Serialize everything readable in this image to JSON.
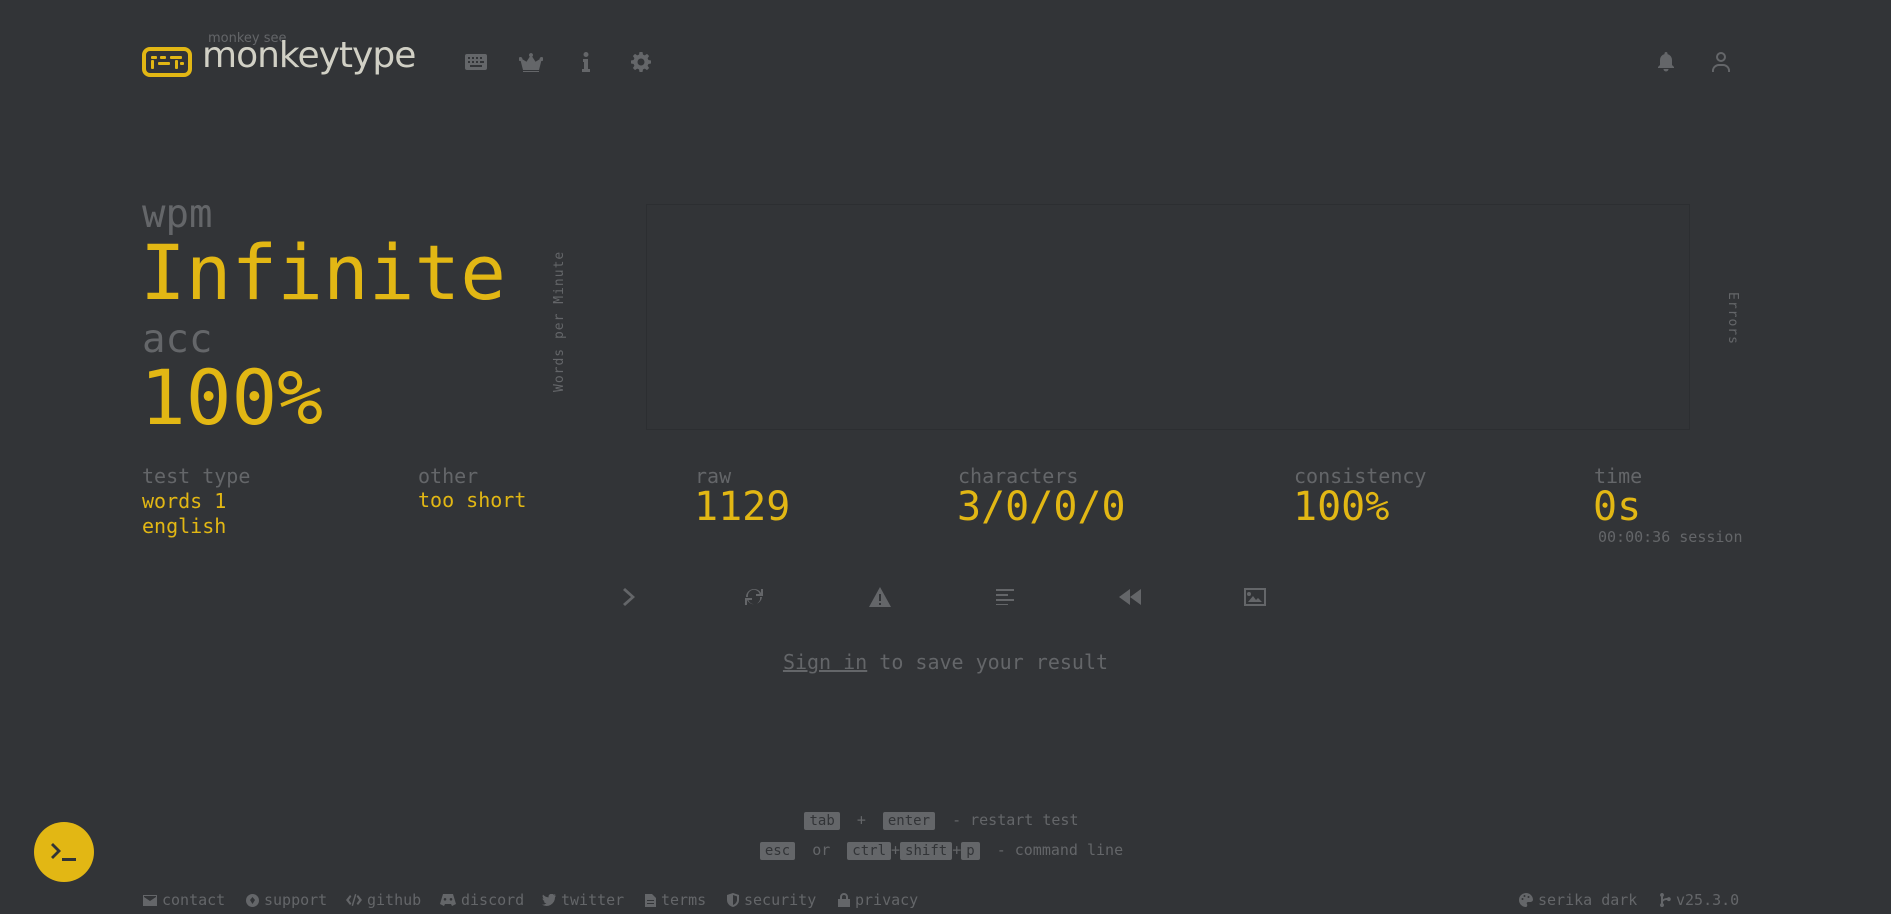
{
  "header": {
    "logo_sub": "monkey see",
    "logo_text": "monkeytype",
    "nav_icons": [
      "keyboard-icon",
      "crown-icon",
      "info-icon",
      "gear-icon"
    ],
    "right_icons": [
      "bell-icon",
      "user-icon"
    ]
  },
  "result": {
    "wpm_label": "wpm",
    "wpm_value": "Infinite",
    "acc_label": "acc",
    "acc_value": "100%"
  },
  "chart": {
    "ylabel": "Words per Minute",
    "y2label": "Errors"
  },
  "stats": {
    "test_type": {
      "label": "test type",
      "line1": "words 1",
      "line2": "english"
    },
    "other": {
      "label": "other",
      "value": "too short"
    },
    "raw": {
      "label": "raw",
      "value": "1129"
    },
    "characters": {
      "label": "characters",
      "value": "3/0/0/0"
    },
    "consistency": {
      "label": "consistency",
      "value": "100%"
    },
    "time": {
      "label": "time",
      "value": "0s",
      "session": "00:00:36 session"
    }
  },
  "actions": [
    "next-test",
    "restart-test",
    "report",
    "words-history",
    "replay",
    "screenshot"
  ],
  "signin": {
    "link": "Sign in",
    "rest": " to save your result"
  },
  "tips": {
    "line1": {
      "k1": "tab",
      "plus": "+",
      "k2": "enter",
      "text": "- restart test"
    },
    "line2": {
      "k1": "esc",
      "or": "or",
      "k2": "ctrl",
      "plus1": "+",
      "k3": "shift",
      "plus2": "+",
      "k4": "p",
      "text": "- command line"
    }
  },
  "footer": {
    "contact": "contact",
    "support": "support",
    "github": "github",
    "discord": "discord",
    "twitter": "twitter",
    "terms": "terms",
    "security": "security",
    "privacy": "privacy",
    "theme": "serika dark",
    "version": "v25.3.0"
  },
  "colors": {
    "background": "#323437",
    "main": "#e2b714",
    "sub": "#646669",
    "text": "#d1d0c5"
  }
}
